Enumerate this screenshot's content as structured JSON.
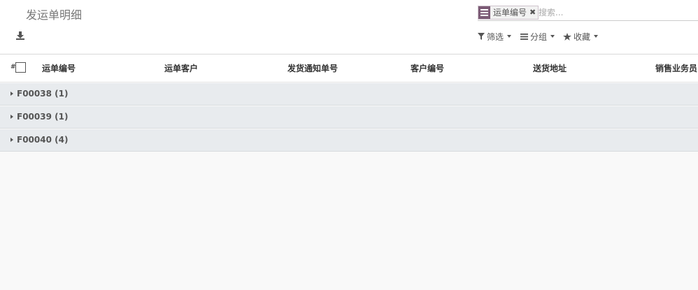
{
  "page": {
    "title": "发运单明细"
  },
  "search": {
    "facet_value": "运单编号",
    "facet_remove": "✖",
    "placeholder": "搜索..."
  },
  "filters": {
    "filter_label": "筛选",
    "group_label": "分组",
    "favorites_label": "收藏"
  },
  "list": {
    "row_number_symbol": "#",
    "columns": [
      "运单编号",
      "运单客户",
      "发货通知单号",
      "客户编号",
      "送货地址",
      "销售业务员"
    ],
    "groups": [
      {
        "label": "F00038 (1)"
      },
      {
        "label": "F00039 (1)"
      },
      {
        "label": "F00040 (4)"
      }
    ]
  },
  "icons": {
    "download": "download-icon",
    "facet": "list-icon",
    "filter": "funnel-icon",
    "group": "bars-icon",
    "favorite": "star-icon"
  },
  "colors": {
    "facet_accent": "#7c5b76",
    "group_row_bg": "#e8ebee"
  }
}
